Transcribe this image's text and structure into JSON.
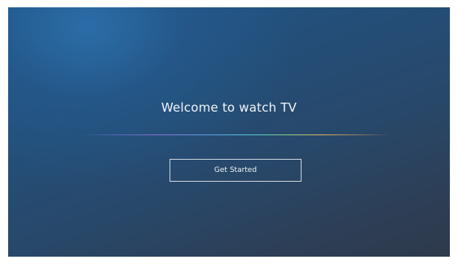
{
  "welcome": {
    "title": "Welcome to watch TV"
  },
  "actions": {
    "get_started_label": "Get Started"
  },
  "colors": {
    "background_top_left": "#22588a",
    "background_bottom_right": "#2f3a4c",
    "text": "#f2f5f8",
    "divider_gradient": [
      "#8a6fd6",
      "#5aa0e6",
      "#4fc4d8",
      "#7ccf8a",
      "#e0b25a"
    ]
  }
}
